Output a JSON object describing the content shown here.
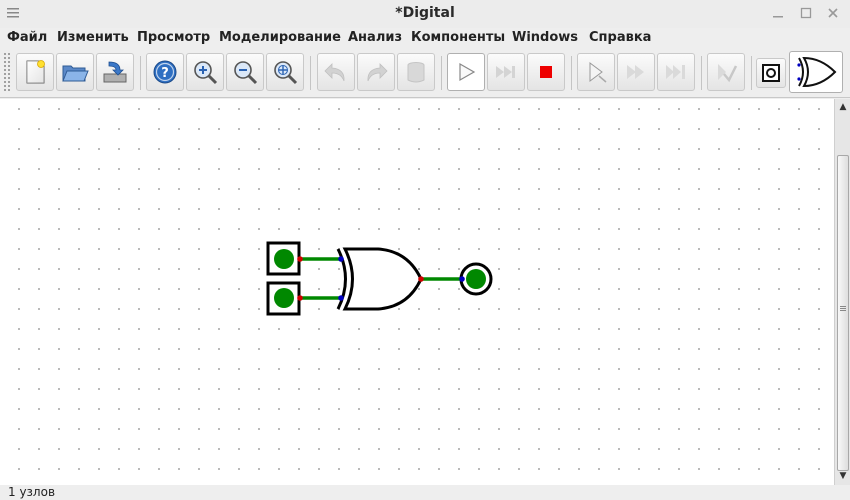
{
  "window": {
    "title": "*Digital"
  },
  "menubar": {
    "items": [
      {
        "label": "Файл"
      },
      {
        "label": "Изменить"
      },
      {
        "label": "Просмотр"
      },
      {
        "label": "Моделирование"
      },
      {
        "label": "Анализ"
      },
      {
        "label": "Компоненты"
      },
      {
        "label": "Windows"
      },
      {
        "label": "Справка"
      }
    ]
  },
  "toolbar": {
    "buttons": [
      {
        "icon": "new-file-icon"
      },
      {
        "icon": "open-folder-icon"
      },
      {
        "icon": "save-icon"
      },
      {
        "icon": "help-icon"
      },
      {
        "icon": "zoom-in-icon"
      },
      {
        "icon": "zoom-out-icon"
      },
      {
        "icon": "zoom-fit-icon"
      },
      {
        "icon": "undo-icon",
        "enabled": false
      },
      {
        "icon": "redo-icon",
        "enabled": false
      },
      {
        "icon": "delete-icon",
        "enabled": false
      },
      {
        "icon": "run-icon"
      },
      {
        "icon": "fast-forward-icon",
        "enabled": false
      },
      {
        "icon": "stop-icon"
      },
      {
        "icon": "step-icon",
        "enabled": false
      },
      {
        "icon": "step-double-icon",
        "enabled": false
      },
      {
        "icon": "step-triple-icon",
        "enabled": false
      },
      {
        "icon": "analyze-icon",
        "enabled": false
      },
      {
        "icon": "output-component-icon"
      },
      {
        "icon": "xor-gate-icon"
      }
    ]
  },
  "colors": {
    "wire": "#008800",
    "input_pin": "#d00000",
    "gate_pin": "#0000c0",
    "led": "#008800",
    "stop": "#ee0000"
  },
  "status": {
    "text": "1 узлов"
  }
}
